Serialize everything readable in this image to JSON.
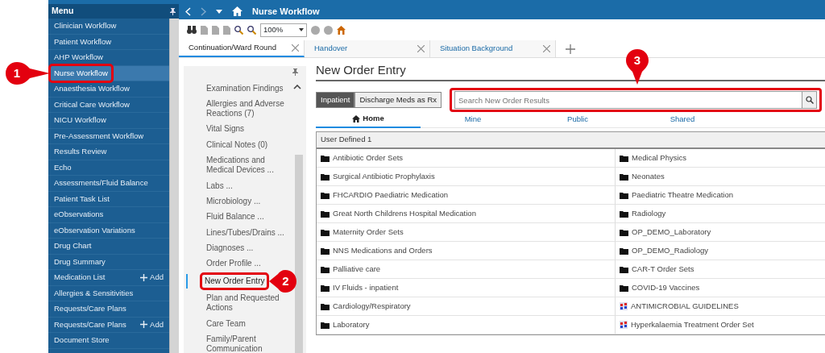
{
  "top_bar": {
    "title": "Nurse Workflow"
  },
  "menu": {
    "title": "Menu",
    "items": [
      {
        "label": "Clinician Workflow",
        "selected": false
      },
      {
        "label": "Patient Workflow",
        "selected": false
      },
      {
        "label": "AHP Workflow",
        "selected": false
      },
      {
        "label": "Nurse Workflow",
        "selected": true,
        "highlighted": true,
        "callout": "1"
      },
      {
        "label": "Anaesthesia Workflow",
        "selected": false
      },
      {
        "label": "Critical Care Workflow",
        "selected": false
      },
      {
        "label": "NICU Workflow",
        "selected": false
      },
      {
        "label": "Pre-Assessment Workflow",
        "selected": false
      },
      {
        "label": "Results Review",
        "selected": false
      },
      {
        "label": "Echo",
        "selected": false
      },
      {
        "label": "Assessments/Fluid Balance",
        "selected": false
      },
      {
        "label": "Patient Task List",
        "selected": false
      },
      {
        "label": "eObservations",
        "selected": false
      },
      {
        "label": "eObservation Variations",
        "selected": false
      },
      {
        "label": "Drug Chart",
        "selected": false
      },
      {
        "label": "Drug Summary",
        "selected": false
      },
      {
        "label": "Medication List",
        "selected": false,
        "action": "Add"
      },
      {
        "label": "Allergies & Sensitivities",
        "selected": false
      },
      {
        "label": "Requests/Care Plans",
        "selected": false
      },
      {
        "label": "Requests/Care Plans",
        "selected": false,
        "action": "Add"
      },
      {
        "label": "Document Store",
        "selected": false
      }
    ]
  },
  "toolbar": {
    "zoom": "100%"
  },
  "tabs": [
    {
      "label": "Continuation/Ward Round",
      "selected": true
    },
    {
      "label": "Handover",
      "selected": false
    },
    {
      "label": "Situation Background",
      "selected": false
    }
  ],
  "sidebar": {
    "items": [
      {
        "label": "Examination Findings",
        "selected": false
      },
      {
        "label": "Allergies and Adverse Reactions (7)",
        "selected": false
      },
      {
        "label": "Vital Signs",
        "selected": false
      },
      {
        "label": "Clinical Notes (0)",
        "selected": false
      },
      {
        "label": "Medications and Medical Devices ...",
        "selected": false
      },
      {
        "label": "Labs ...",
        "selected": false
      },
      {
        "label": "Microbiology ...",
        "selected": false
      },
      {
        "label": "Fluid Balance ...",
        "selected": false
      },
      {
        "label": "Lines/Tubes/Drains ...",
        "selected": false
      },
      {
        "label": "Diagnoses ...",
        "selected": false
      },
      {
        "label": "Order Profile ...",
        "selected": false
      },
      {
        "label": "New Order Entry",
        "selected": true,
        "highlighted": true,
        "callout": "2"
      },
      {
        "label": "Plan and Requested Actions",
        "selected": false
      },
      {
        "label": "Care Team",
        "selected": false
      },
      {
        "label": "Family/Parent Communication",
        "selected": false
      }
    ]
  },
  "order_entry": {
    "title": "New Order Entry",
    "modes": [
      {
        "label": "Inpatient",
        "selected": true
      },
      {
        "label": "Discharge Meds as Rx",
        "selected": false
      }
    ],
    "search": {
      "placeholder": "Search New Order Results",
      "highlighted": true,
      "callout": "3"
    },
    "filters": [
      {
        "label": "Home",
        "selected": true
      },
      {
        "label": "Mine",
        "selected": false
      },
      {
        "label": "Public",
        "selected": false
      },
      {
        "label": "Shared",
        "selected": false
      }
    ],
    "section": "User Defined 1",
    "folders": [
      {
        "label": "Antibiotic Order Sets",
        "kind": "folder"
      },
      {
        "label": "Medical Physics",
        "kind": "folder"
      },
      {
        "label": "Surgical Antibiotic Prophylaxis",
        "kind": "folder"
      },
      {
        "label": "Neonates",
        "kind": "folder"
      },
      {
        "label": "FHCARDIO Paediatric Medication",
        "kind": "folder"
      },
      {
        "label": "Paediatric Theatre Medication",
        "kind": "folder"
      },
      {
        "label": "Great North Childrens Hospital Medication",
        "kind": "folder"
      },
      {
        "label": "Radiology",
        "kind": "folder"
      },
      {
        "label": "Maternity Order Sets",
        "kind": "folder"
      },
      {
        "label": "OP_DEMO_Laboratory",
        "kind": "folder"
      },
      {
        "label": "NNS Medications and Orders",
        "kind": "folder"
      },
      {
        "label": "OP_DEMO_Radiology",
        "kind": "folder"
      },
      {
        "label": "Palliative care",
        "kind": "folder"
      },
      {
        "label": "CAR-T Order Sets",
        "kind": "folder"
      },
      {
        "label": "IV Fluids - inpatient",
        "kind": "folder"
      },
      {
        "label": "COVID-19 Vaccines",
        "kind": "folder"
      },
      {
        "label": "Cardiology/Respiratory",
        "kind": "folder"
      },
      {
        "label": "ANTIMICROBIAL GUIDELINES",
        "kind": "order-set"
      },
      {
        "label": "Laboratory",
        "kind": "folder"
      },
      {
        "label": "Hyperkalaemia Treatment Order Set",
        "kind": "order-set"
      }
    ]
  }
}
